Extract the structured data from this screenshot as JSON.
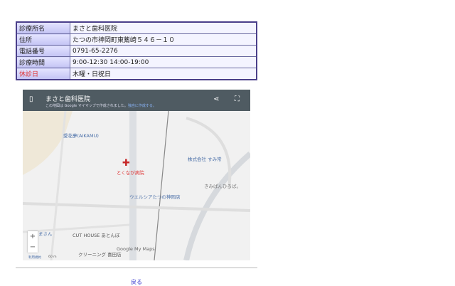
{
  "info_table": [
    {
      "label": "診療所名",
      "value": "まさと歯科医院",
      "holiday": false
    },
    {
      "label": "住所",
      "value": "たつの市神岡町東觜崎５４６－１０",
      "holiday": false
    },
    {
      "label": "電話番号",
      "value": "0791-65-2276",
      "holiday": false
    },
    {
      "label": "診療時間",
      "value": "9:00-12:30 14:00-19:00",
      "holiday": false
    },
    {
      "label": "休診日",
      "value": "木曜・日祝日",
      "holiday": true
    }
  ],
  "map": {
    "title": "まさと歯科医院",
    "subtitle": "この地図は Google マイマップで作成されました。",
    "subtitle_link": "独自に作成する。",
    "labels": [
      "愛花夢(AIKAMU)",
      "とくなが病院",
      "株式会社 すみ常",
      "きみぱんひろば。",
      "ウエルシアたつの神岡店",
      "まさん",
      "CUT HOUSE あとんぼ",
      "クリーニング 喜田店",
      "Google My Maps",
      "利用規約",
      "60 m"
    ],
    "zoom_in": "+",
    "zoom_out": "−"
  },
  "back_link": "戻る"
}
